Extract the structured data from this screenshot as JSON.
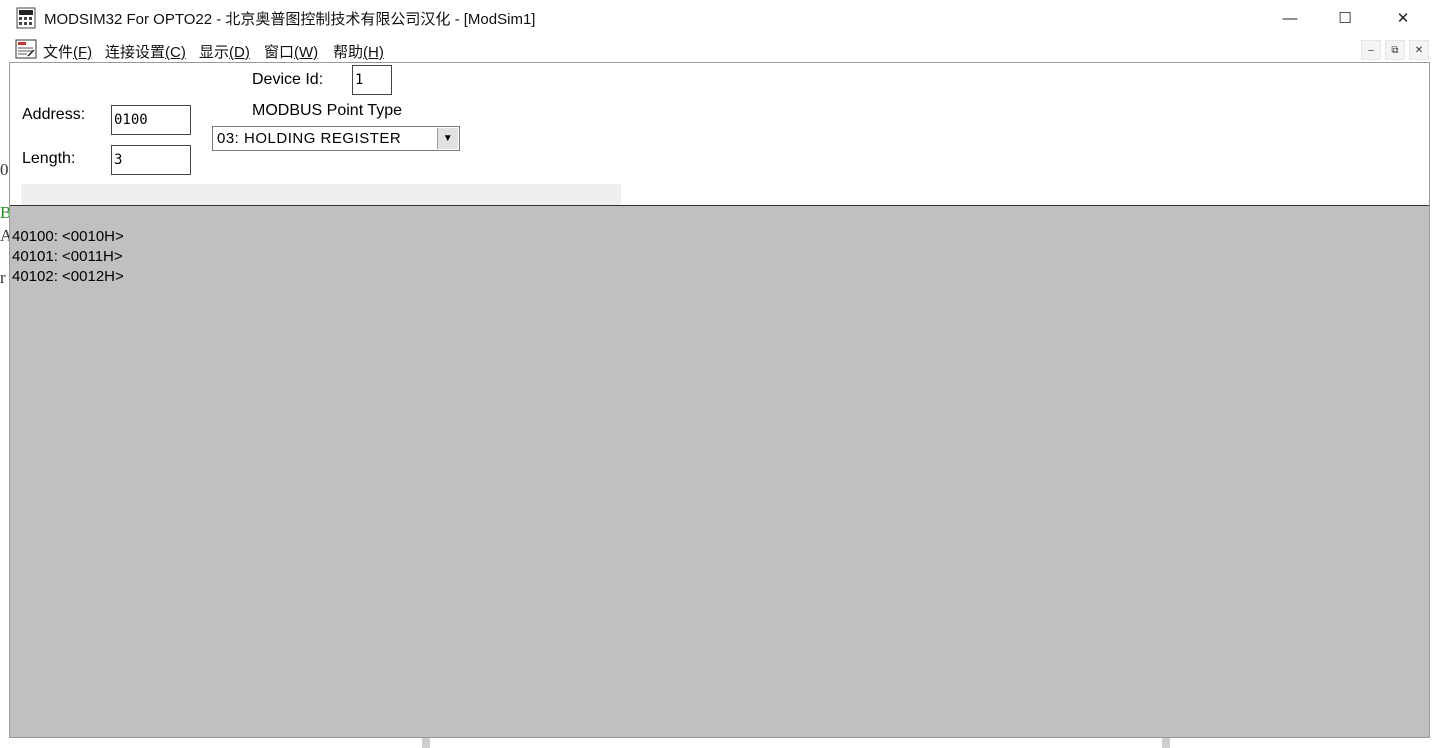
{
  "window": {
    "title": "MODSIM32 For OPTO22 - 北京奥普图控制技术有限公司汉化 - [ModSim1]",
    "controls": {
      "minimize": "—",
      "maximize": "☐",
      "close": "✕"
    },
    "app_icon": "modsim-app-icon"
  },
  "menubar": {
    "doc_icon": "document-icon",
    "items": [
      {
        "label": "文件",
        "key": "(F)"
      },
      {
        "label": "连接设置",
        "key": "(C)"
      },
      {
        "label": "显示",
        "key": "(D)"
      },
      {
        "label": "窗口",
        "key": "(W)"
      },
      {
        "label": "帮助",
        "key": "(H)"
      }
    ],
    "mdi": {
      "minimize": "–",
      "restore": "⧉",
      "close": "✕"
    }
  },
  "form": {
    "device_id_label": "Device Id:",
    "device_id_value": "1",
    "address_label": "Address:",
    "address_value": "0100",
    "length_label": "Length:",
    "length_value": "3",
    "point_type_label": "MODBUS Point Type",
    "point_type_value": "03: HOLDING REGISTER"
  },
  "registers": [
    {
      "text": "40100: <0010H>"
    },
    {
      "text": "40101: <0011H>"
    },
    {
      "text": "40102: <0012H>"
    }
  ],
  "background_fragments": {
    "left": [
      "0",
      "B",
      "A",
      "r"
    ]
  }
}
